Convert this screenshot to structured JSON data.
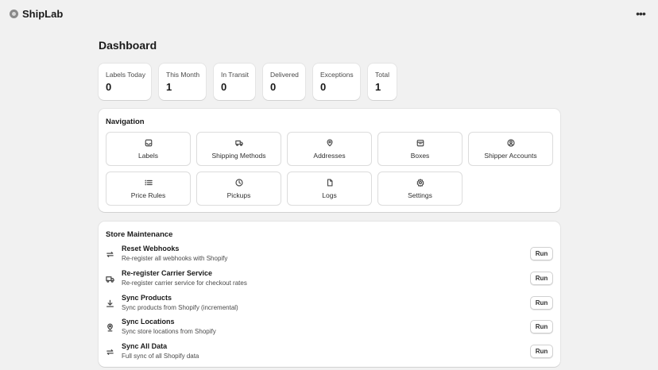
{
  "app": {
    "title": "ShipLab",
    "logo_icon": "app-logo-icon",
    "menu_icon": "more-horizontal-icon"
  },
  "page": {
    "title": "Dashboard"
  },
  "stats": [
    {
      "label": "Labels Today",
      "value": "0"
    },
    {
      "label": "This Month",
      "value": "1"
    },
    {
      "label": "In Transit",
      "value": "0"
    },
    {
      "label": "Delivered",
      "value": "0"
    },
    {
      "label": "Exceptions",
      "value": "0"
    },
    {
      "label": "Total",
      "value": "1"
    }
  ],
  "navigation": {
    "title": "Navigation",
    "items": [
      {
        "label": "Labels",
        "icon": "inbox-icon"
      },
      {
        "label": "Shipping Methods",
        "icon": "truck-icon"
      },
      {
        "label": "Addresses",
        "icon": "location-pin-icon"
      },
      {
        "label": "Boxes",
        "icon": "package-icon"
      },
      {
        "label": "Shipper Accounts",
        "icon": "person-circle-icon"
      },
      {
        "label": "Price Rules",
        "icon": "list-icon"
      },
      {
        "label": "Pickups",
        "icon": "clock-icon"
      },
      {
        "label": "Logs",
        "icon": "document-icon"
      },
      {
        "label": "Settings",
        "icon": "gear-icon"
      }
    ]
  },
  "maintenance": {
    "title": "Store Maintenance",
    "run_label": "Run",
    "tasks": [
      {
        "name": "Reset Webhooks",
        "description": "Re-register all webhooks with Shopify",
        "icon": "refresh-icon"
      },
      {
        "name": "Re-register Carrier Service",
        "description": "Re-register carrier service for checkout rates",
        "icon": "truck-icon"
      },
      {
        "name": "Sync Products",
        "description": "Sync products from Shopify (incremental)",
        "icon": "download-icon"
      },
      {
        "name": "Sync Locations",
        "description": "Sync store locations from Shopify",
        "icon": "location-pin-icon"
      },
      {
        "name": "Sync All Data",
        "description": "Full sync of all Shopify data",
        "icon": "refresh-icon"
      }
    ]
  }
}
